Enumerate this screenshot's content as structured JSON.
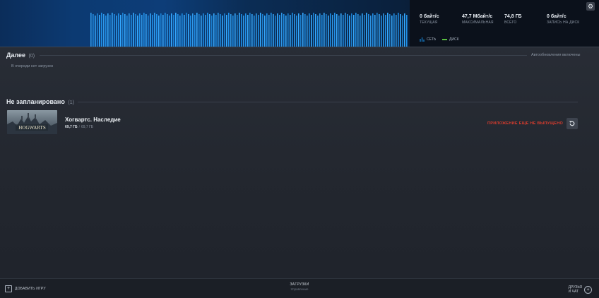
{
  "header": {
    "stats": [
      {
        "value": "0 байт/с",
        "label": "ТЕКУЩАЯ"
      },
      {
        "value": "47,7 Мбайт/с",
        "label": "МАКСИМАЛЬНАЯ"
      },
      {
        "value": "74,8 ГБ",
        "label": "ВСЕГО"
      },
      {
        "value": "0 байт/с",
        "label": "ЗАПИСЬ НА ДИСК"
      }
    ],
    "legend": {
      "network": "СЕТЬ",
      "disk": "ДИСК"
    },
    "gear_icon": "gear-icon"
  },
  "up_next": {
    "title": "Далее",
    "count": "(0)",
    "empty_text": "В очереди нет загрузок",
    "auto_updates": "Автообновления включены"
  },
  "unscheduled": {
    "title": "Не запланировано",
    "count": "(1)",
    "items": [
      {
        "title": "Хогвартс. Наследие",
        "size_done": "69,7 ГБ",
        "size_sep": "/",
        "size_total": "69,7 ГБ",
        "status": "ПРИЛОЖЕНИЕ ЕЩЕ НЕ ВЫПУЩЕНО",
        "thumb_logo": "HOGWARTS"
      }
    ]
  },
  "footer": {
    "add_game": "ДОБАВИТЬ ИГРУ",
    "downloads": "ЗАГРУЗКИ",
    "downloads_sub": "Управление",
    "friends": "ДРУЗЬЯ\nИ ЧАТ"
  },
  "colors": {
    "accent_blue": "#1a9fff",
    "status_red": "#d93c2e",
    "disk_green": "#59bf40"
  }
}
